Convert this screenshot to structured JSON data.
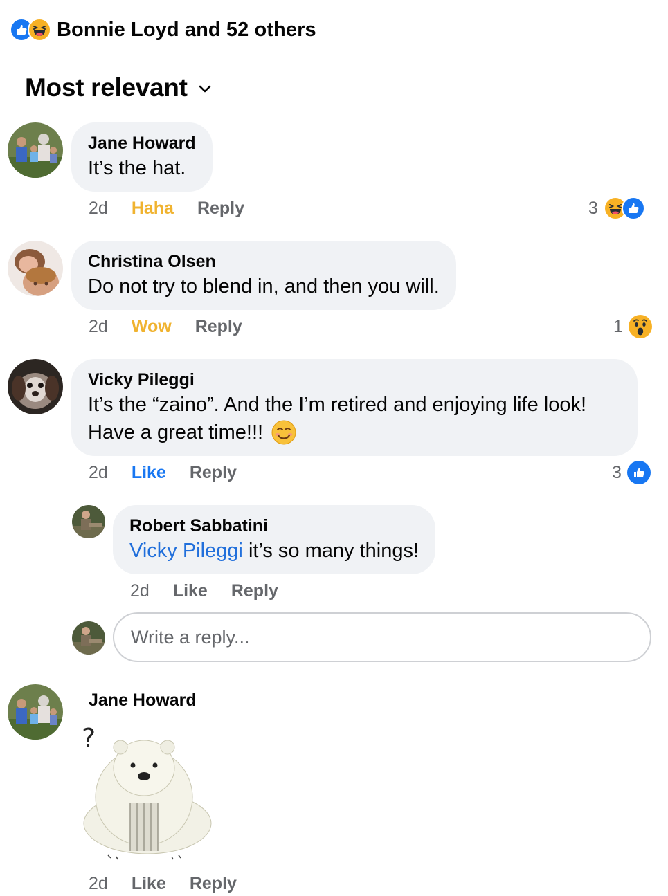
{
  "reactions_summary": {
    "text": "Bonnie Loyd and 52 others",
    "icons": [
      "like-icon",
      "haha-icon"
    ]
  },
  "sort": {
    "label": "Most relevant"
  },
  "comments": [
    {
      "author": "Jane Howard",
      "text": "It’s the hat.",
      "time": "2d",
      "reaction_label": "Haha",
      "reply_label": "Reply",
      "reaction_count": "3",
      "reaction_icons": [
        "haha-icon",
        "like-icon"
      ]
    },
    {
      "author": "Christina Olsen",
      "text": "Do not try to blend in, and then you will.",
      "time": "2d",
      "reaction_label": "Wow",
      "reply_label": "Reply",
      "reaction_count": "1",
      "reaction_icons": [
        "wow-icon"
      ]
    },
    {
      "author": "Vicky Pileggi",
      "text_line1": "It’s the “zaino”. And the I’m retired and enjoying life look!",
      "text_line2": "Have a great time!!!",
      "emoji": "smiling-face-icon",
      "time": "2d",
      "reaction_label": "Like",
      "reply_label": "Reply",
      "reaction_count": "3",
      "reaction_icons": [
        "like-icon"
      ]
    },
    {
      "author": "Robert Sabbatini",
      "mention": "Vicky Pileggi",
      "text": " it’s so many things!",
      "time": "2d",
      "reaction_label": "Like",
      "reply_label": "Reply"
    },
    {
      "author": "Jane Howard",
      "sticker": "polar-bear-question-sticker",
      "time": "2d",
      "reaction_label": "Like",
      "reply_label": "Reply"
    }
  ],
  "reply_input": {
    "placeholder": "Write a reply..."
  },
  "colors": {
    "like_blue": "#1877f2",
    "reaction_yellow": "#f0b330",
    "bubble_bg": "#f0f2f5",
    "meta_gray": "#65676b",
    "mention_blue": "#216fdb"
  }
}
